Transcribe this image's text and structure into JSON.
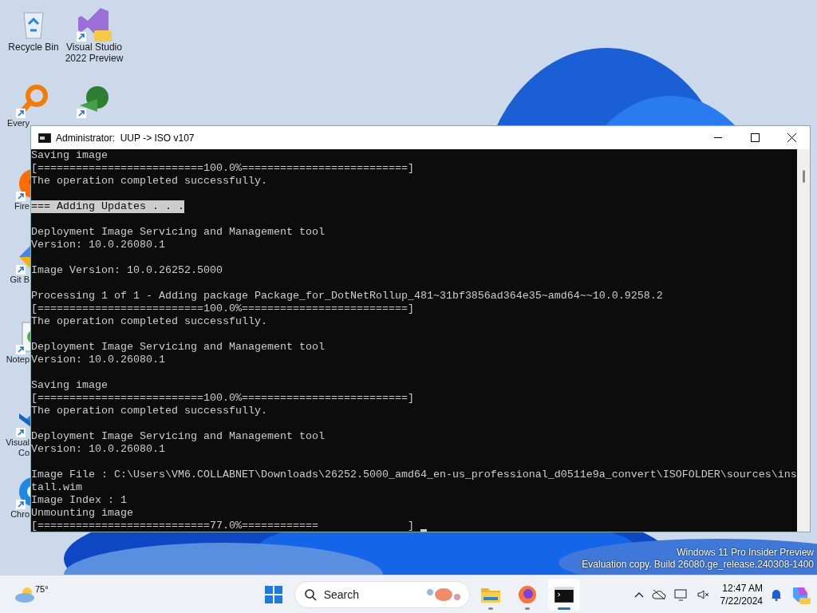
{
  "desktop_icons": [
    {
      "label": "Recycle Bin"
    },
    {
      "label": "Visual Studio 2022 Preview"
    },
    {
      "label": "Every"
    },
    {
      "label": "Fire"
    },
    {
      "label": "Git B"
    },
    {
      "label": "Notep"
    },
    {
      "label": "Visual Co"
    },
    {
      "label": "Chro"
    }
  ],
  "window": {
    "title": "Administrator:  UUP -> ISO v107",
    "blocks": [
      {
        "lines": [
          {
            "text": "Saving image",
            "highlighted": false
          },
          {
            "text": "[==========================100.0%==========================]",
            "highlighted": false
          },
          {
            "text": "The operation completed successfully.",
            "highlighted": false
          }
        ]
      },
      {
        "lines": [
          {
            "text": "=== Adding Updates . . .",
            "highlighted": true
          }
        ]
      },
      {
        "lines": [
          {
            "text": "Deployment Image Servicing and Management tool",
            "highlighted": false
          },
          {
            "text": "Version: 10.0.26080.1",
            "highlighted": false
          }
        ]
      },
      {
        "lines": [
          {
            "text": "Image Version: 10.0.26252.5000",
            "highlighted": false
          }
        ]
      },
      {
        "lines": [
          {
            "text": "Processing 1 of 1 - Adding package Package_for_DotNetRollup_481~31bf3856ad364e35~amd64~~10.0.9258.2",
            "highlighted": false
          },
          {
            "text": "[==========================100.0%==========================]",
            "highlighted": false
          },
          {
            "text": "The operation completed successfully.",
            "highlighted": false
          }
        ]
      },
      {
        "lines": [
          {
            "text": "Deployment Image Servicing and Management tool",
            "highlighted": false
          },
          {
            "text": "Version: 10.0.26080.1",
            "highlighted": false
          }
        ]
      },
      {
        "lines": [
          {
            "text": "Saving image",
            "highlighted": false
          },
          {
            "text": "[==========================100.0%==========================]",
            "highlighted": false
          },
          {
            "text": "The operation completed successfully.",
            "highlighted": false
          }
        ]
      },
      {
        "lines": [
          {
            "text": "Deployment Image Servicing and Management tool",
            "highlighted": false
          },
          {
            "text": "Version: 10.0.26080.1",
            "highlighted": false
          }
        ]
      },
      {
        "lines": [
          {
            "text": "Image File : C:\\Users\\VM6.COLLABNET\\Downloads\\26252.5000_amd64_en-us_professional_d0511e9a_convert\\ISOFOLDER\\sources\\ins",
            "highlighted": false
          },
          {
            "text": "tall.wim",
            "highlighted": false
          },
          {
            "text": "Image Index : 1",
            "highlighted": false
          },
          {
            "text": "Unmounting image",
            "highlighted": false
          },
          {
            "text": "[===========================77.0%============              ]",
            "highlighted": false
          }
        ]
      }
    ]
  },
  "watermark": [
    "Windows 11 Pro Insider Preview",
    "Evaluation copy. Build 26080.ge_release.240308-1400"
  ],
  "taskbar": {
    "weather": "75°",
    "search": {
      "placeholder": "Search"
    },
    "apps": [
      {
        "selected": false
      },
      {
        "selected": false
      },
      {
        "selected": true
      }
    ],
    "time": "12:47 AM",
    "date": "7/22/2024"
  }
}
